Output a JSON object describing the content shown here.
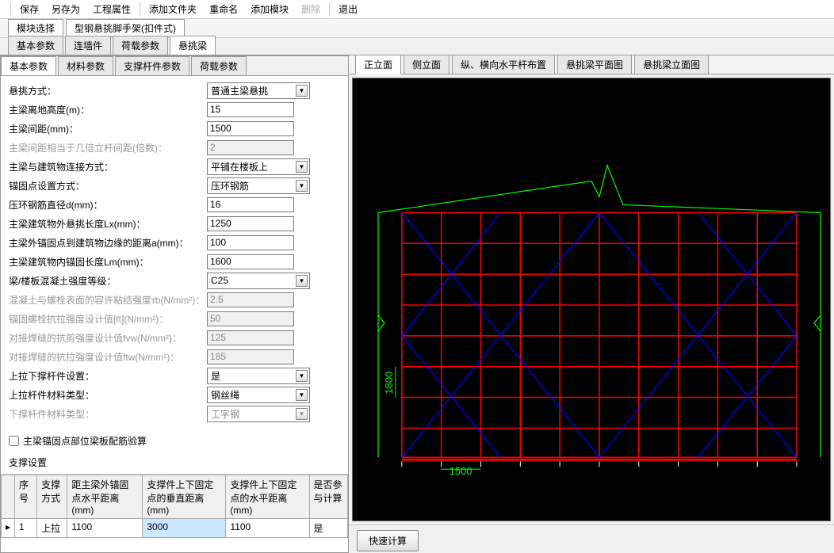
{
  "toolbar": {
    "save": "保存",
    "saveAs": "另存为",
    "props": "工程属性",
    "addFolder": "添加文件夹",
    "rename": "重命名",
    "addModule": "添加模块",
    "delete": "删除",
    "exit": "退出"
  },
  "moduleRow": {
    "moduleSelect": "模块选择",
    "steelCantilever": "型钢悬挑脚手架(扣件式)"
  },
  "tabs": {
    "basic": "基本参数",
    "wall": "连墙件",
    "load": "荷载参数",
    "cantilever": "悬挑梁"
  },
  "subtabs": {
    "basic": "基本参数",
    "material": "材料参数",
    "support": "支撑杆件参数",
    "load": "荷载参数"
  },
  "form": {
    "cantileverMode": {
      "label": "悬挑方式：",
      "value": "普通主梁悬挑"
    },
    "beamHeight": {
      "label": "主梁离地高度(m)：",
      "value": "15"
    },
    "beamSpacing": {
      "label": "主梁间距(mm)：",
      "value": "1500"
    },
    "spacingRatio": {
      "label": "主梁间距相当于几倍立杆间距(倍数)：",
      "value": "2"
    },
    "connectMode": {
      "label": "主梁与建筑物连接方式：",
      "value": "平铺在楼板上"
    },
    "anchorMode": {
      "label": "锚固点设置方式：",
      "value": "压环钢筋"
    },
    "ringDiameter": {
      "label": "压环钢筋直径d(mm)：",
      "value": "16"
    },
    "cantileverLen": {
      "label": "主梁建筑物外悬挑长度Lx(mm)：",
      "value": "1250"
    },
    "anchorEdgeDist": {
      "label": "主梁外锚固点到建筑物边缘的距离a(mm)：",
      "value": "100"
    },
    "innerAnchorLen": {
      "label": "主梁建筑物内锚固长度Lm(mm)：",
      "value": "1600"
    },
    "concreteGrade": {
      "label": "梁/楼板混凝土强度等级：",
      "value": "C25"
    },
    "bondStrength": {
      "label": "混凝土与螺栓表面的容许粘结强度τb(N/mm²)：",
      "value": "2.5"
    },
    "boltTensile": {
      "label": "锚固螺栓抗拉强度设计值[ft](N/mm²)：",
      "value": "50"
    },
    "weldShear": {
      "label": "对接焊缝的抗剪强度设计值fvw(N/mm²)：",
      "value": "125"
    },
    "weldTensile": {
      "label": "对接焊缝的抗拉强度设计值ftw(N/mm²)：",
      "value": "185"
    },
    "topBottomSupport": {
      "label": "上拉下撑杆件设置：",
      "value": "是"
    },
    "topMaterial": {
      "label": "上拉杆件材料类型：",
      "value": "钢丝绳"
    },
    "bottomMaterial": {
      "label": "下撑杆件材料类型：",
      "value": "工字钢"
    }
  },
  "checkbox": {
    "label": "主梁锚固点部位梁板配筋验算"
  },
  "supportSection": {
    "title": "支撑设置"
  },
  "table": {
    "headers": {
      "num": "序号",
      "mode": "支撑方式",
      "horizDist": "距主梁外锚固点水平距离(mm)",
      "topVert": "支撑件上下固定点的垂直距离(mm)",
      "topHoriz": "支撑件上下固定点的水平距离(mm)",
      "calc": "是否参与计算"
    },
    "row": {
      "num": "1",
      "mode": "上拉",
      "horizDist": "1100",
      "topVert": "3000",
      "topHoriz": "1100",
      "calc": "是"
    }
  },
  "viewTabs": {
    "front": "正立面",
    "side": "侧立面",
    "horizontal": "纵、横向水平杆布置",
    "plan": "悬挑梁平面图",
    "elevation": "悬挑梁立面图"
  },
  "drawing": {
    "dim1": "1800",
    "dim2": "1500"
  },
  "calcBtn": "快速计算"
}
